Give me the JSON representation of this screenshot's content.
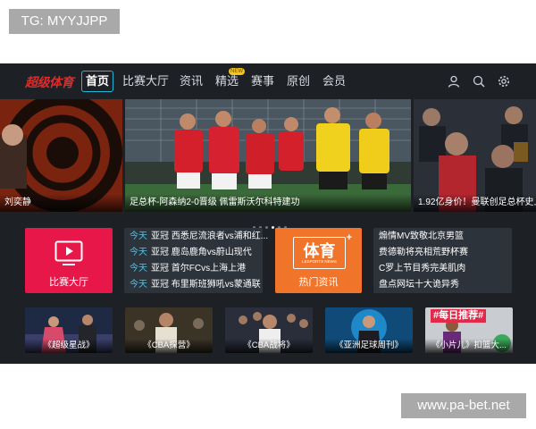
{
  "overlay": {
    "tag": "TG: MYYJJPP",
    "watermark": "www.pa-bet.net"
  },
  "app": {
    "logo": "超级体育"
  },
  "nav": {
    "items": [
      "首页",
      "比赛大厅",
      "资讯",
      "精选",
      "赛事",
      "原创",
      "会员"
    ],
    "badge": "NEW"
  },
  "icons": [
    "user-icon",
    "search-icon",
    "settings-icon"
  ],
  "banners": {
    "left_caption": "刘奕静",
    "main_caption": "足总杯-阿森纳2-0晋级 佩雷斯沃尔科特建功",
    "right_caption": "1.92亿身价！曼联创足总杯史上"
  },
  "carousel": {
    "count": 6,
    "active": 3
  },
  "tiles": {
    "match_hall": "比赛大厅",
    "news_logo": "体育",
    "news_logo_sub": "LESPORTS NEWS",
    "news_label": "热门资讯"
  },
  "schedule": [
    {
      "day": "今天",
      "text": "亚冠 西悉尼流浪者vs浦和红..."
    },
    {
      "day": "今天",
      "text": "亚冠 鹿岛鹿角vs蔚山现代"
    },
    {
      "day": "今天",
      "text": "亚冠 首尔FCvs上海上港"
    },
    {
      "day": "今天",
      "text": "亚冠 布里斯班狮吼vs蒙通联"
    }
  ],
  "headlines": [
    "煽情MV致敬北京男篮",
    "费德勒将亮相荒野杯赛",
    "C罗上节目秀完美肌肉",
    "盘点网坛十大诡异秀"
  ],
  "thumbnails": [
    {
      "caption": "《超级星战》"
    },
    {
      "caption": "《CBA探营》"
    },
    {
      "caption": "《CBA战将》"
    },
    {
      "caption": "《亚洲足球周刊》"
    },
    {
      "caption": "《小片儿》扣篮大...",
      "badge": "#每日推荐#"
    }
  ],
  "colors": {
    "accent": "#20b8d8",
    "logo": "#e02a2a",
    "match_tile": "#e8174a",
    "news_tile": "#f0742a",
    "day": "#4fc3e8"
  }
}
